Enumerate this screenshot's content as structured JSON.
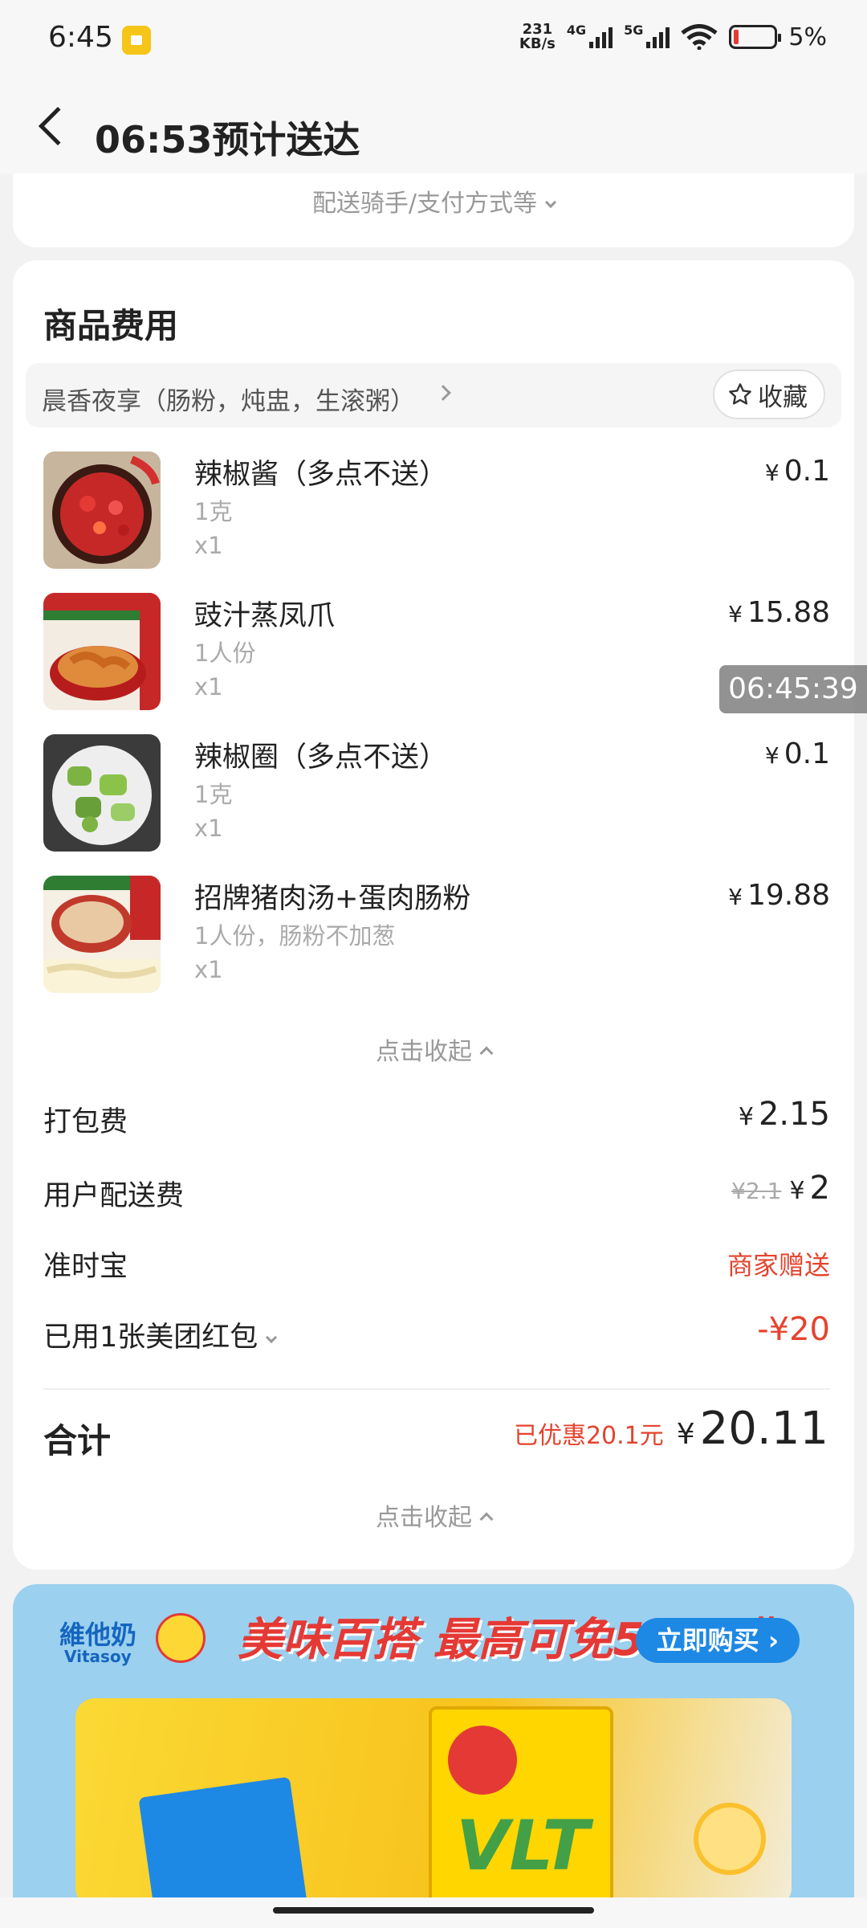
{
  "status_bar": {
    "time": "6:45",
    "net_speed_value": "231",
    "net_speed_unit": "KB/s",
    "signal1_label": "4G",
    "signal2_label": "5G",
    "battery_percent": "5%"
  },
  "header": {
    "title": "06:53预计送达"
  },
  "prev_card": {
    "text": "配送骑手/支付方式等"
  },
  "goods": {
    "section_title": "商品费用",
    "store_name": "晨香夜享（肠粉，炖盅，生滚粥）",
    "favorite_label": "收藏",
    "items": [
      {
        "name": "辣椒酱（多点不送）",
        "spec": "1克",
        "qty": "x1",
        "price": "0.1"
      },
      {
        "name": "豉汁蒸凤爪",
        "spec": "1人份",
        "qty": "x1",
        "price": "15.88"
      },
      {
        "name": "辣椒圈（多点不送）",
        "spec": "1克",
        "qty": "x1",
        "price": "0.1"
      },
      {
        "name": "招牌猪肉汤+蛋肉肠粉",
        "spec": "1人份，肠粉不加葱",
        "qty": "x1",
        "price": "19.88"
      }
    ],
    "collapse_label": "点击收起"
  },
  "fees": {
    "packing_label": "打包费",
    "packing_value": "2.15",
    "delivery_label": "用户配送费",
    "delivery_original": "¥2.1",
    "delivery_value": "2",
    "ontime_label": "准时宝",
    "ontime_value": "商家赠送",
    "coupon_label": "已用1张美团红包",
    "coupon_value": "-¥20"
  },
  "total": {
    "label": "合计",
    "saved": "已优惠20.1元",
    "amount": "20.11",
    "collapse_label": "点击收起"
  },
  "currency": "¥",
  "timestamp_overlay": "06:45:39",
  "ad": {
    "brand": "維他奶",
    "brand_sub": "Vitasoy",
    "slogan": "美味百搭 最高可免5元运费",
    "button": "立即购买",
    "product": "VLT"
  },
  "colors": {
    "accent_red": "#e5432e",
    "ad_blue": "#1e88e5"
  }
}
